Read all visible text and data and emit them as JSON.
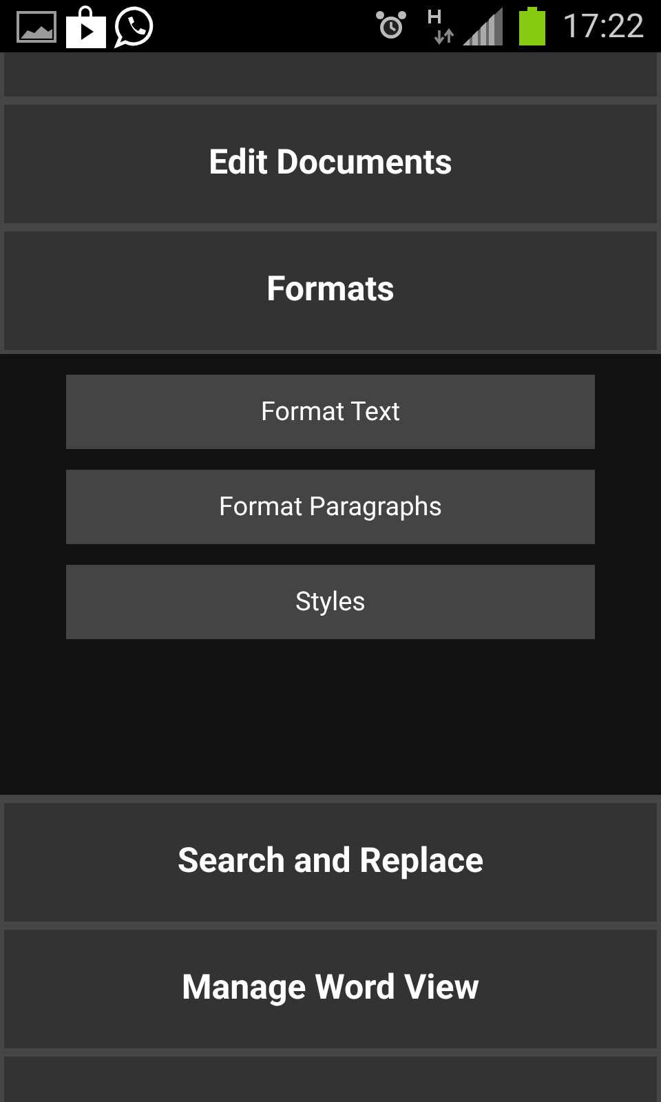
{
  "status_bar": {
    "time": "17:22"
  },
  "sections": [
    {
      "label": "Edit Documents",
      "expanded": false
    },
    {
      "label": "Formats",
      "expanded": true,
      "children": [
        {
          "label": "Format Text"
        },
        {
          "label": "Format Paragraphs"
        },
        {
          "label": "Styles"
        }
      ]
    },
    {
      "label": "Search and Replace",
      "expanded": false
    },
    {
      "label": "Manage Word View",
      "expanded": false
    }
  ]
}
